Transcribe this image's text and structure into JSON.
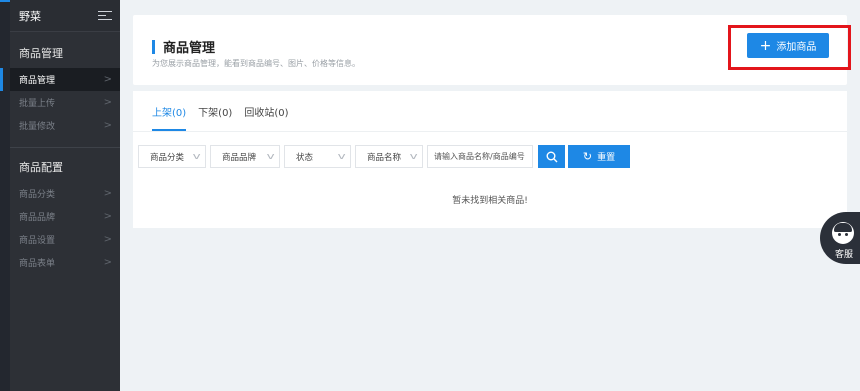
{
  "sidebar": {
    "brand": "野菜",
    "sections": [
      {
        "title": "商品管理",
        "items": [
          {
            "label": "商品管理",
            "active": true
          },
          {
            "label": "批量上传",
            "active": false
          },
          {
            "label": "批量修改",
            "active": false
          }
        ]
      },
      {
        "title": "商品配置",
        "items": [
          {
            "label": "商品分类",
            "active": false
          },
          {
            "label": "商品品牌",
            "active": false
          },
          {
            "label": "商品设置",
            "active": false
          },
          {
            "label": "商品表单",
            "active": false
          }
        ]
      }
    ]
  },
  "header": {
    "title": "商品管理",
    "description": "为您展示商品管理，能看到商品编号、图片、价格等信息。",
    "add_button": "添加商品"
  },
  "tabs": [
    {
      "label": "上架(0)",
      "active": true
    },
    {
      "label": "下架(0)",
      "active": false
    },
    {
      "label": "回收站(0)",
      "active": false
    }
  ],
  "filters": {
    "category": "商品分类",
    "brand": "商品品牌",
    "status": "状态",
    "name_field": "商品名称",
    "search_placeholder": "请输入商品名称/商品编号",
    "reset_label": "重置"
  },
  "empty_message": "暂未找到相关商品!",
  "customer_service": "客服",
  "colors": {
    "accent": "#1e88e5",
    "sidebar_bg": "#2d3036",
    "highlight": "#e3151b"
  }
}
